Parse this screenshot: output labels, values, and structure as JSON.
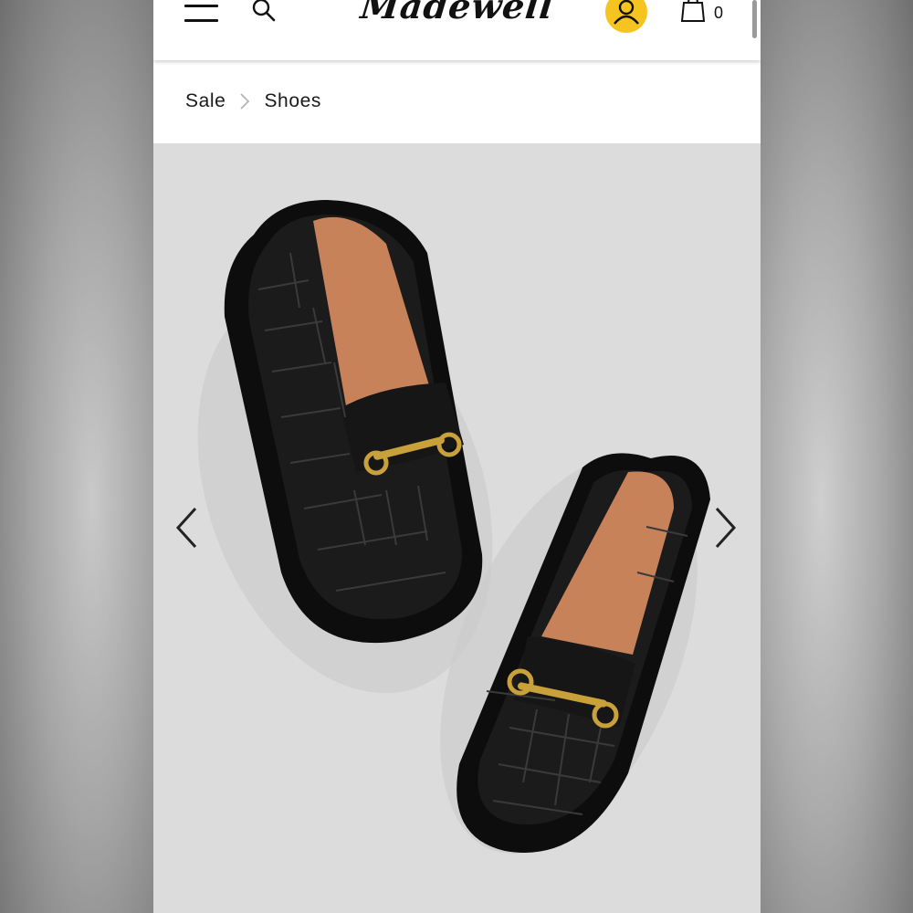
{
  "header": {
    "logo_text": "Madewell",
    "menu_icon": "hamburger-menu-icon",
    "search_icon": "search-icon",
    "account_icon": "user-account-icon",
    "account_color": "#f6c420",
    "cart_icon": "shopping-bag-icon",
    "cart_count": "0"
  },
  "breadcrumb": {
    "items": [
      {
        "label": "Sale"
      },
      {
        "label": "Shoes"
      }
    ],
    "separator_icon": "chevron-right-icon"
  },
  "gallery": {
    "image_subject": "black croc-embossed lugsole loafers with gold bit hardware",
    "background_color": "#dcdcdc",
    "prev_icon": "chevron-left-icon",
    "next_icon": "chevron-right-icon"
  },
  "colors": {
    "text": "#1a1a1a",
    "accent": "#f6c420",
    "shoe_leather": "#111111",
    "hardware_gold": "#c9a13a",
    "lining": "#c8825a"
  }
}
